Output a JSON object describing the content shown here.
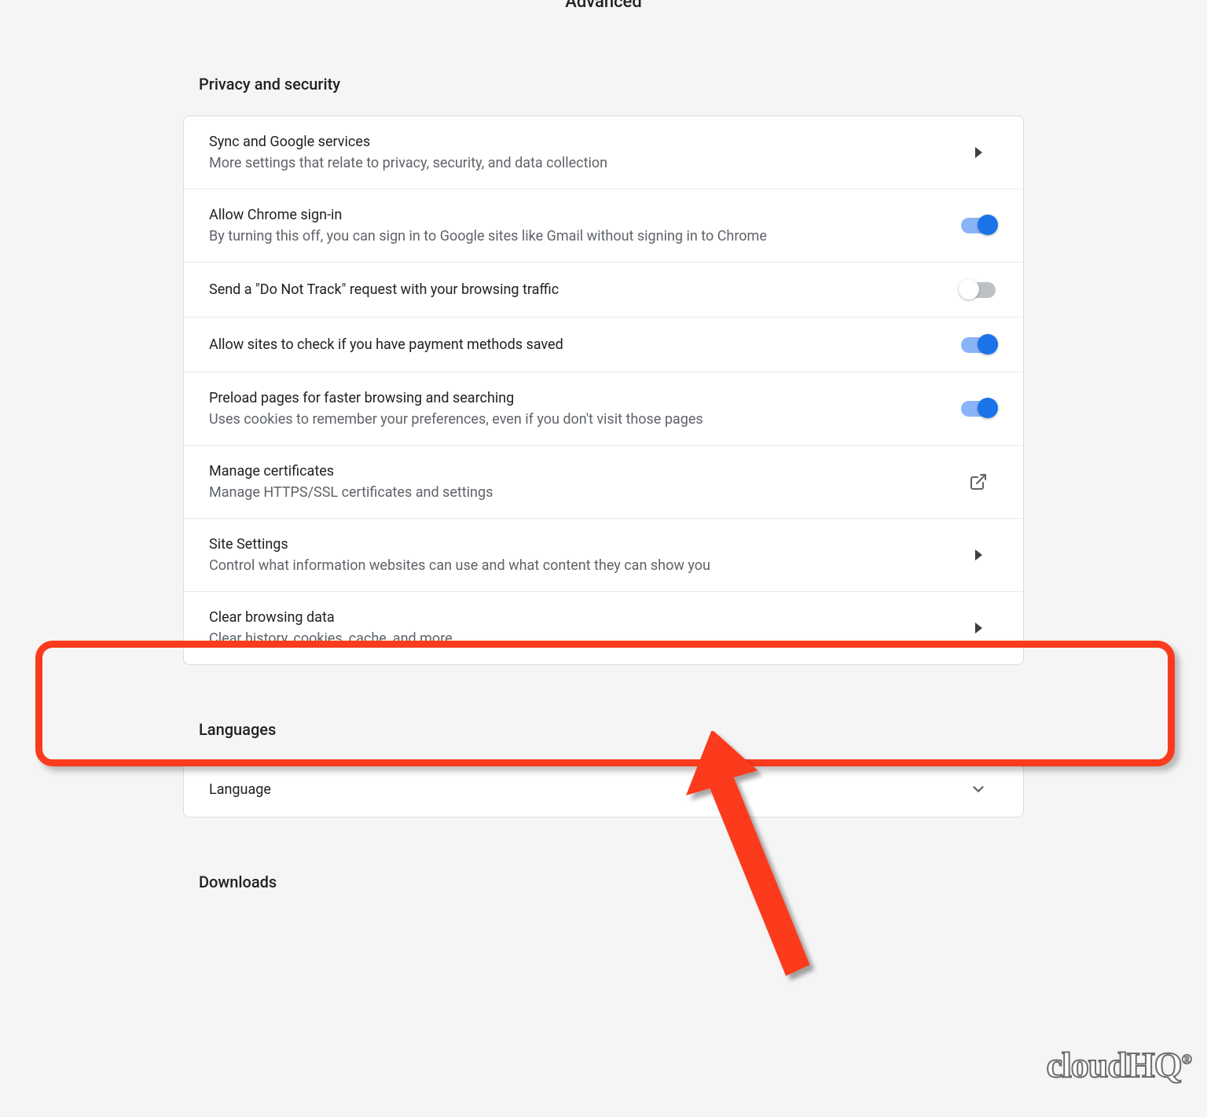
{
  "header": {
    "advanced_label": "Advanced"
  },
  "sections": {
    "privacy": {
      "title": "Privacy and security",
      "rows": {
        "sync": {
          "title": "Sync and Google services",
          "sub": "More settings that relate to privacy, security, and data collection"
        },
        "signin": {
          "title": "Allow Chrome sign-in",
          "sub": "By turning this off, you can sign in to Google sites like Gmail without signing in to Chrome"
        },
        "dnt": {
          "title": "Send a \"Do Not Track\" request with your browsing traffic"
        },
        "payment": {
          "title": "Allow sites to check if you have payment methods saved"
        },
        "preload": {
          "title": "Preload pages for faster browsing and searching",
          "sub": "Uses cookies to remember your preferences, even if you don't visit those pages"
        },
        "certs": {
          "title": "Manage certificates",
          "sub": "Manage HTTPS/SSL certificates and settings"
        },
        "site": {
          "title": "Site Settings",
          "sub": "Control what information websites can use and what content they can show you"
        },
        "clear": {
          "title": "Clear browsing data",
          "sub": "Clear history, cookies, cache, and more"
        }
      }
    },
    "languages": {
      "title": "Languages",
      "rows": {
        "language": {
          "title": "Language"
        }
      }
    },
    "downloads": {
      "title": "Downloads"
    }
  },
  "watermark": "cloudHQ"
}
